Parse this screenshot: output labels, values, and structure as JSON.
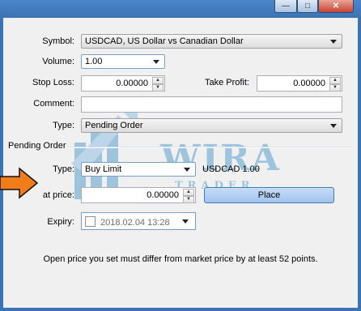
{
  "window": {
    "minimize_glyph": "—",
    "maximize_glyph": "□",
    "close_glyph": "✕"
  },
  "form": {
    "symbol_label": "Symbol:",
    "symbol_value": "USDCAD, US Dollar vs Canadian Dollar",
    "volume_label": "Volume:",
    "volume_value": "1.00",
    "stop_loss_label": "Stop Loss:",
    "stop_loss_value": "0.00000",
    "take_profit_label": "Take Profit:",
    "take_profit_value": "0.00000",
    "comment_label": "Comment:",
    "comment_value": "",
    "type_label": "Type:",
    "type_value": "Pending Order"
  },
  "pending": {
    "group_title": "Pending Order",
    "type_label": "Type:",
    "type_value": "Buy Limit",
    "symbol_info": "USDCAD 1.00",
    "at_price_label": "at price:",
    "at_price_value": "0.00000",
    "place_label": "Place",
    "expiry_label": "Expiry:",
    "expiry_value": "2018.02.04 13:28"
  },
  "message": "Open price you set must differ from market price by at least 52 points.",
  "watermark": {
    "brand": "WIRA",
    "sub": "TRADER"
  },
  "colors": {
    "titlebar": "#3b73b3",
    "place_button": "#a2c3ef",
    "arrow": "#f07d1a",
    "watermark": "#3d8fc7"
  }
}
